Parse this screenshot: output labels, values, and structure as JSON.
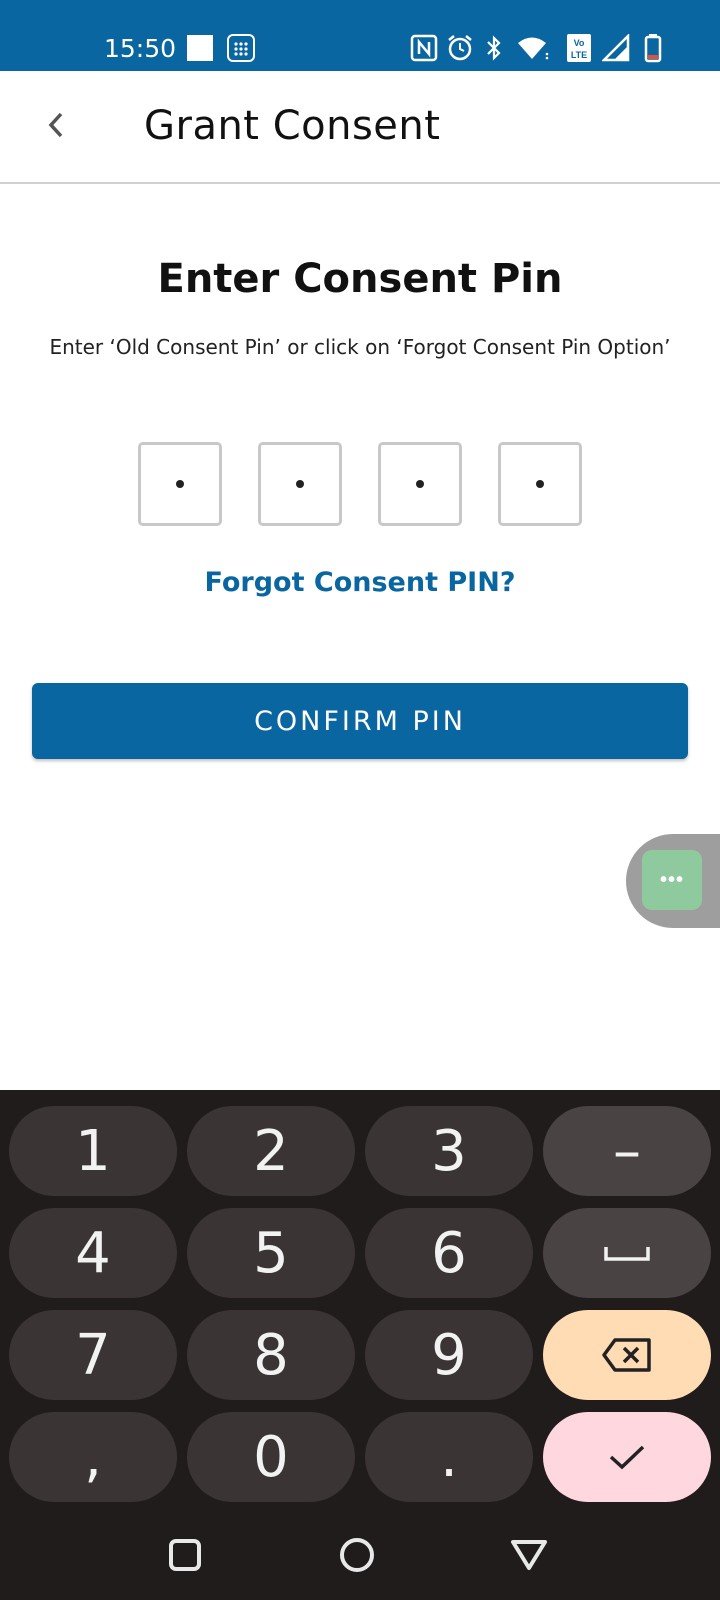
{
  "status_bar": {
    "time": "15:50",
    "icons": [
      "square-icon",
      "dialpad-icon",
      "nfc-icon",
      "alarm-icon",
      "bluetooth-icon",
      "wifi-icon",
      "volte-icon",
      "signal-icon",
      "battery-icon"
    ],
    "background": "#0a66a0"
  },
  "app_bar": {
    "title": "Grant Consent",
    "back_icon": "chevron-left-icon"
  },
  "main": {
    "heading": "Enter Consent Pin",
    "subtext": "Enter ‘Old Consent Pin’ or click on ‘Forgot Consent Pin Option’",
    "pin_boxes": 4,
    "forgot_link": "Forgot Consent PIN?",
    "confirm_label": "CONFIRM PIN",
    "accent": "#0a66a0"
  },
  "floating_bubble": {
    "label": "•••",
    "color": "#8fc99e"
  },
  "keyboard": {
    "keys": {
      "k1": "1",
      "k2": "2",
      "k3": "3",
      "minus": "–",
      "k4": "4",
      "k5": "5",
      "k6": "6",
      "k7": "7",
      "k8": "8",
      "k9": "9",
      "comma": ",",
      "k0": "0",
      "period": "."
    },
    "space_icon": "space-bar-icon",
    "backspace_icon": "backspace-icon",
    "done_icon": "checkmark-icon",
    "backspace_color": "#ffdcb4",
    "done_color": "#ffd8df"
  },
  "nav_bar": {
    "icons": [
      "recents-square-icon",
      "home-circle-icon",
      "back-triangle-icon"
    ]
  }
}
